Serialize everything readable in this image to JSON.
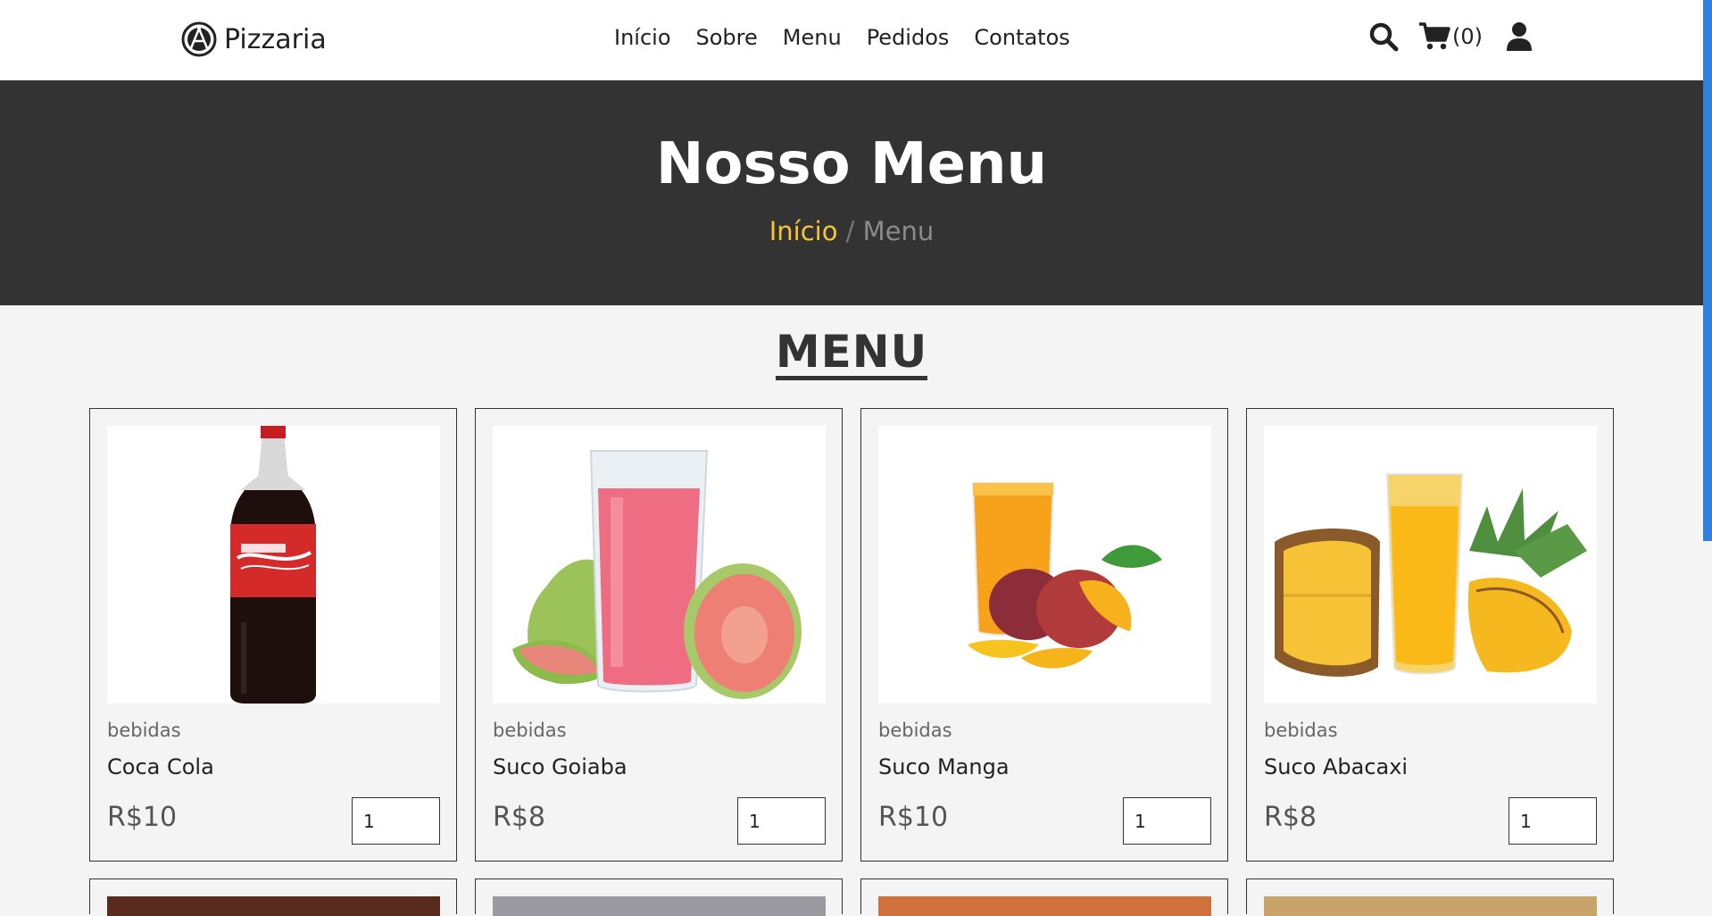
{
  "header": {
    "brand": "Pizzaria",
    "nav": [
      "Início",
      "Sobre",
      "Menu",
      "Pedidos",
      "Contatos"
    ],
    "cart_count": "(0)",
    "icons": [
      "search-icon",
      "cart-icon",
      "user-icon"
    ]
  },
  "hero": {
    "title": "Nosso Menu",
    "breadcrumb_home": "Início",
    "breadcrumb_sep": "/",
    "breadcrumb_current": "Menu"
  },
  "section": {
    "title": "MENU"
  },
  "products": [
    {
      "category": "bebidas",
      "name": "Coca Cola",
      "price": "R$10",
      "qty": "1",
      "image": "coca-cola-bottle"
    },
    {
      "category": "bebidas",
      "name": "Suco Goiaba",
      "price": "R$8",
      "qty": "1",
      "image": "guava-juice"
    },
    {
      "category": "bebidas",
      "name": "Suco Manga",
      "price": "R$10",
      "qty": "1",
      "image": "mango-juice"
    },
    {
      "category": "bebidas",
      "name": "Suco Abacaxi",
      "price": "R$8",
      "qty": "1",
      "image": "pineapple-juice"
    }
  ],
  "colors": {
    "accent": "#f6c531",
    "hero_bg": "#333333",
    "page_bg": "#f4f4f4",
    "scroll_thumb": "#2f7fe0"
  }
}
